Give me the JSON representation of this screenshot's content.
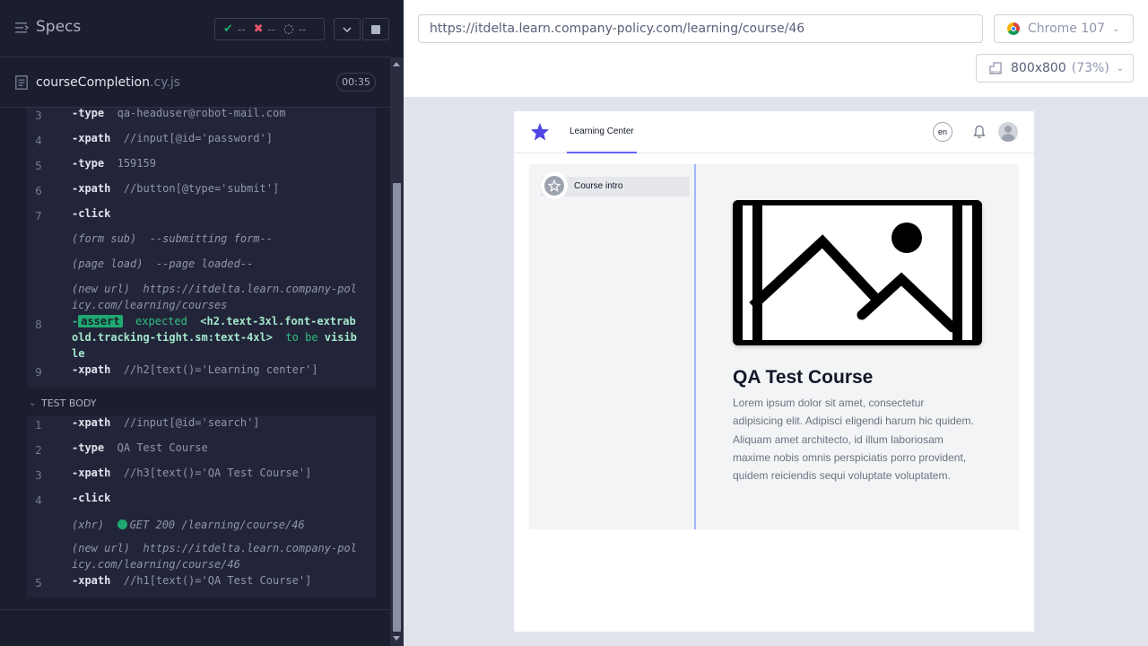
{
  "reporter": {
    "title": "Specs",
    "stats": {
      "passed": "--",
      "failed": "--",
      "pending": "--"
    },
    "spec_file": {
      "name": "courseCompletion",
      "ext": ".cy.js",
      "duration": "00:35"
    },
    "before_commands": [
      {
        "num": "3",
        "name": "type",
        "message": "qa-headuser@robot-mail.com"
      },
      {
        "num": "4",
        "name": "xpath",
        "message": "//input[@id='password']"
      },
      {
        "num": "5",
        "name": "type",
        "message": "159159"
      },
      {
        "num": "6",
        "name": "xpath",
        "message": "//button[@type='submit']"
      },
      {
        "num": "7",
        "name": "click",
        "message": ""
      },
      {
        "event": "(form sub)",
        "message": "--submitting form--"
      },
      {
        "event": "(page load)",
        "message": "--page loaded--"
      },
      {
        "event": "(new url)",
        "message": "https://itdelta.learn.company-policy.com/learning/courses"
      },
      {
        "num": "8",
        "name": "assert",
        "expected": "expected",
        "selector": "<h2.text-3xl.font-extrabold.tracking-tight.sm:text-4xl>",
        "to_be": "to be",
        "visible": "visible"
      },
      {
        "num": "9",
        "name": "xpath",
        "message": "//h2[text()='Learning center']"
      }
    ],
    "section_title": "TEST BODY",
    "body_commands": [
      {
        "num": "1",
        "name": "xpath",
        "message": "//input[@id='search']"
      },
      {
        "num": "2",
        "name": "type",
        "message": "QA Test Course"
      },
      {
        "num": "3",
        "name": "xpath",
        "message": "//h3[text()='QA Test Course']"
      },
      {
        "num": "4",
        "name": "click",
        "message": ""
      },
      {
        "event": "(xhr)",
        "message": "GET 200 /learning/course/46"
      },
      {
        "event": "(new url)",
        "message": "https://itdelta.learn.company-policy.com/learning/course/46"
      },
      {
        "num": "5",
        "name": "xpath",
        "message": "//h1[text()='QA Test Course']"
      }
    ]
  },
  "aut": {
    "url": "https://itdelta.learn.company-policy.com/learning/course/46",
    "browser": "Chrome 107",
    "viewport": "800x800",
    "zoom": "(73%)"
  },
  "app": {
    "nav_tab": "Learning Center",
    "lang": "en",
    "sidebar_item": "Course intro",
    "course_title": "QA Test Course",
    "course_desc": "Lorem ipsum dolor sit amet, consectetur adipisicing elit. Adipisci eligendi harum hic quidem. Aliquam amet architecto, id illum laboriosam maxime nobis omnis perspiciatis porro provident, quidem reiciendis sequi voluptate voluptatem."
  },
  "colors": {
    "reporter_bg": "#1b1e2e",
    "command_bg": "#22253a",
    "pass_green": "#1fa971",
    "fail_red": "#e45770",
    "accent_indigo": "#6366f1"
  }
}
